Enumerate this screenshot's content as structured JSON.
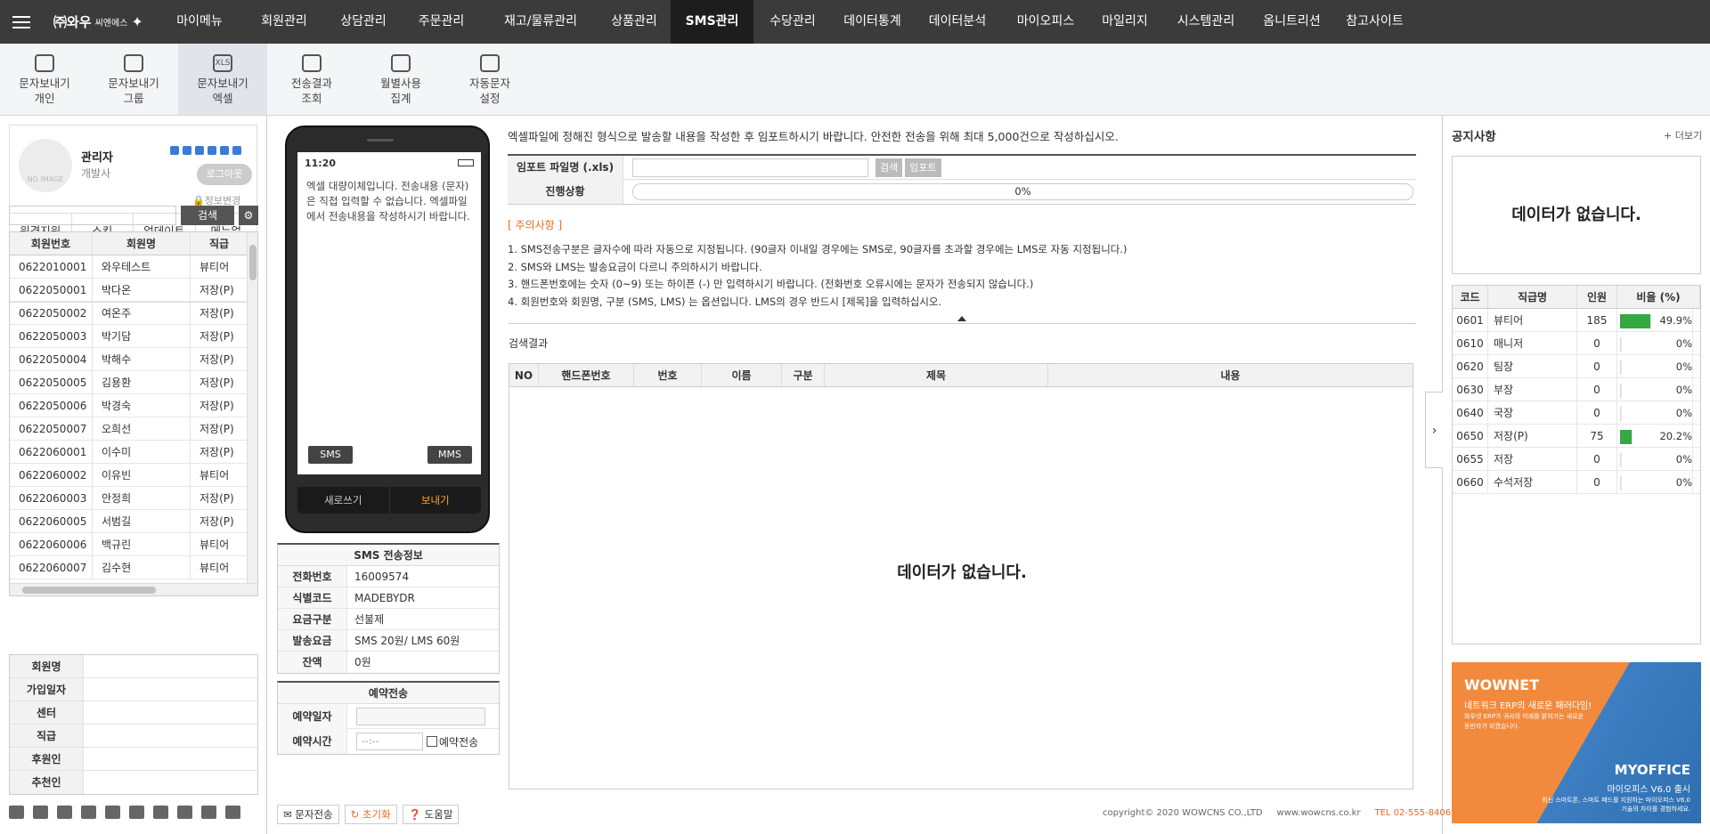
{
  "topbar": {
    "logo_main": "㈜와우",
    "logo_sub": "씨엔에스",
    "menu": [
      "마이메뉴",
      "회원관리",
      "상담관리",
      "주문관리",
      "재고/물류관리",
      "상품관리",
      "SMS관리",
      "수당관리",
      "데이터통계",
      "데이터분석",
      "마이오피스",
      "마일리지",
      "시스템관리",
      "옴니트리션",
      "참고사이트"
    ],
    "active": "SMS관리"
  },
  "submenu": [
    {
      "label": "문자보내기\n개인",
      "icon": "chat-icon"
    },
    {
      "label": "문자보내기\n그룹",
      "icon": "chat-dots-icon"
    },
    {
      "label": "문자보내기\n엑셀",
      "icon": "excel-chat-icon"
    },
    {
      "label": "전송결과\n조회",
      "icon": "chat-result-icon"
    },
    {
      "label": "월별사용\n집계",
      "icon": "calendar-icon"
    },
    {
      "label": "자동문자\n설정",
      "icon": "gear-icon"
    }
  ],
  "profile": {
    "no_image": "NO IMAGE",
    "name": "관리자",
    "role": "개발사",
    "logout": "로그아웃",
    "info_change": "정보변경",
    "tabs": [
      "원격지원",
      "스킨",
      "업데이트",
      "메뉴얼"
    ]
  },
  "left_search": {
    "button": "검색"
  },
  "member_table": {
    "headers": [
      "회원번호",
      "회원명",
      "직급"
    ],
    "rows": [
      [
        "0622010001",
        "와우테스트",
        "뷰티어"
      ],
      [
        "0622050001",
        "박다온",
        "저장(P)"
      ],
      [
        "0622050002",
        "여온주",
        "저장(P)"
      ],
      [
        "0622050003",
        "박기담",
        "저장(P)"
      ],
      [
        "0622050004",
        "박해수",
        "저장(P)"
      ],
      [
        "0622050005",
        "김용환",
        "저장(P)"
      ],
      [
        "0622050006",
        "박경숙",
        "저장(P)"
      ],
      [
        "0622050007",
        "오희선",
        "저장(P)"
      ],
      [
        "0622060001",
        "이수미",
        "저장(P)"
      ],
      [
        "0622060002",
        "이유빈",
        "뷰티어"
      ],
      [
        "0622060003",
        "안정희",
        "저장(P)"
      ],
      [
        "0622060005",
        "서범길",
        "저장(P)"
      ],
      [
        "0622060006",
        "백규린",
        "뷰티어"
      ],
      [
        "0622060007",
        "김수현",
        "뷰티어"
      ]
    ]
  },
  "member_detail": [
    "회원명",
    "가입일자",
    "센터",
    "직급",
    "후원인",
    "추천인"
  ],
  "phone": {
    "time": "11:20",
    "message": "엑셀 대량이체입니다. 전송내용 (문자) 은 직접 입력할 수 없습니다. 엑셀파일에서 전송내용을 작성하시기 바랍니다.",
    "sms": "SMS",
    "mms": "MMS",
    "new": "새로쓰기",
    "send": "보내기"
  },
  "sms_info": {
    "title": "SMS 전송정보",
    "rows": [
      {
        "k": "전화번호",
        "v": "16009574"
      },
      {
        "k": "식별코드",
        "v": "MADEBYDR"
      },
      {
        "k": "요금구분",
        "v": "선불제"
      },
      {
        "k": "발송요금",
        "v": "SMS 20원/ LMS 60원"
      },
      {
        "k": "잔액",
        "v": "0원"
      }
    ]
  },
  "reserve": {
    "title": "예약전송",
    "date_label": "예약일자",
    "time_label": "예약시간",
    "time_placeholder": "--:--",
    "check_label": "예약전송"
  },
  "bottom_buttons": {
    "send": "문자전송",
    "reset": "초기화",
    "help": "도움말"
  },
  "notice_text": "엑셀파일에 정해진 형식으로 발송할 내용을 작성한 후 임포트하시기 바랍니다. 안전한 전송을 위해 최대 5,000건으로 작성하십시오.",
  "form": {
    "file_label": "임포트 파일명 (.xls)",
    "search_btn": "검색",
    "import_btn": "임포트",
    "progress_label": "진행상황",
    "progress_text": "0%",
    "progress_value": 0
  },
  "caution": {
    "title": "[ 주의사항 ]",
    "items": [
      "1. SMS전송구분은 글자수에 따라 자동으로 지정됩니다. (90글자 이내일 경우에는 SMS로, 90글자를 초과할 경우에는 LMS로 자동 지정됩니다.)",
      "2. SMS와 LMS는 발송요금이 다르니 주의하시기 바랍니다.",
      "3. 핸드폰번호에는 숫자 (0~9) 또는 하이픈 (-) 만 입력하시기 바랍니다. (전화번호 오류시에는 문자가 전송되지 않습니다.)",
      "4. 회원번호와 회원명, 구분 (SMS, LMS) 는 옵션입니다. LMS의 경우 반드시 [제목]을 입력하십시오."
    ]
  },
  "result": {
    "title": "검색결과",
    "headers": [
      "NO",
      "핸드폰번호",
      "번호",
      "이름",
      "구분",
      "제목",
      "내용"
    ],
    "empty": "데이터가 없습니다."
  },
  "copyright": {
    "text": "copyright© 2020 WOWCNS CO.,LTD",
    "site": "www.wowcns.co.kr",
    "tel": "TEL 02-555-8406"
  },
  "notice_panel": {
    "title": "공지사항",
    "more": "+ 더보기",
    "empty": "데이터가 없습니다."
  },
  "grade_table": {
    "headers": [
      "코드",
      "직급명",
      "인원",
      "비율 (%)"
    ],
    "rows": [
      {
        "code": "0601",
        "name": "뷰티어",
        "count": "185",
        "pct": "49.9%",
        "ratio": 49.9
      },
      {
        "code": "0610",
        "name": "매니저",
        "count": "0",
        "pct": "0%",
        "ratio": 0
      },
      {
        "code": "0620",
        "name": "팀장",
        "count": "0",
        "pct": "0%",
        "ratio": 0
      },
      {
        "code": "0630",
        "name": "부장",
        "count": "0",
        "pct": "0%",
        "ratio": 0
      },
      {
        "code": "0640",
        "name": "국장",
        "count": "0",
        "pct": "0%",
        "ratio": 0
      },
      {
        "code": "0650",
        "name": "저장(P)",
        "count": "75",
        "pct": "20.2%",
        "ratio": 20.2
      },
      {
        "code": "0655",
        "name": "저장",
        "count": "0",
        "pct": "0%",
        "ratio": 0
      },
      {
        "code": "0660",
        "name": "수석저장",
        "count": "0",
        "pct": "0%",
        "ratio": 0
      }
    ]
  },
  "banner": {
    "t1": "WOWNET",
    "t2": "네트워크 ERP의 새로운 패러다임!",
    "t3": "와우넷 ERP가 귀사의 미래를 밝혀가는 새로운 동반자가 되겠습니다.",
    "t4": "MYOFFICE",
    "t5": "마이오피스 V6.0 출시",
    "t6": "최신 스마트폰, 스마트 패드를 지원하는 마이오피스 V6.0 기술의 차이를 경험하세요."
  },
  "colors": {
    "topbar": "#3b3b3b",
    "active_menu": "#1d1d1d",
    "accent_orange": "#e06b2b",
    "bar_green": "#35a841"
  }
}
